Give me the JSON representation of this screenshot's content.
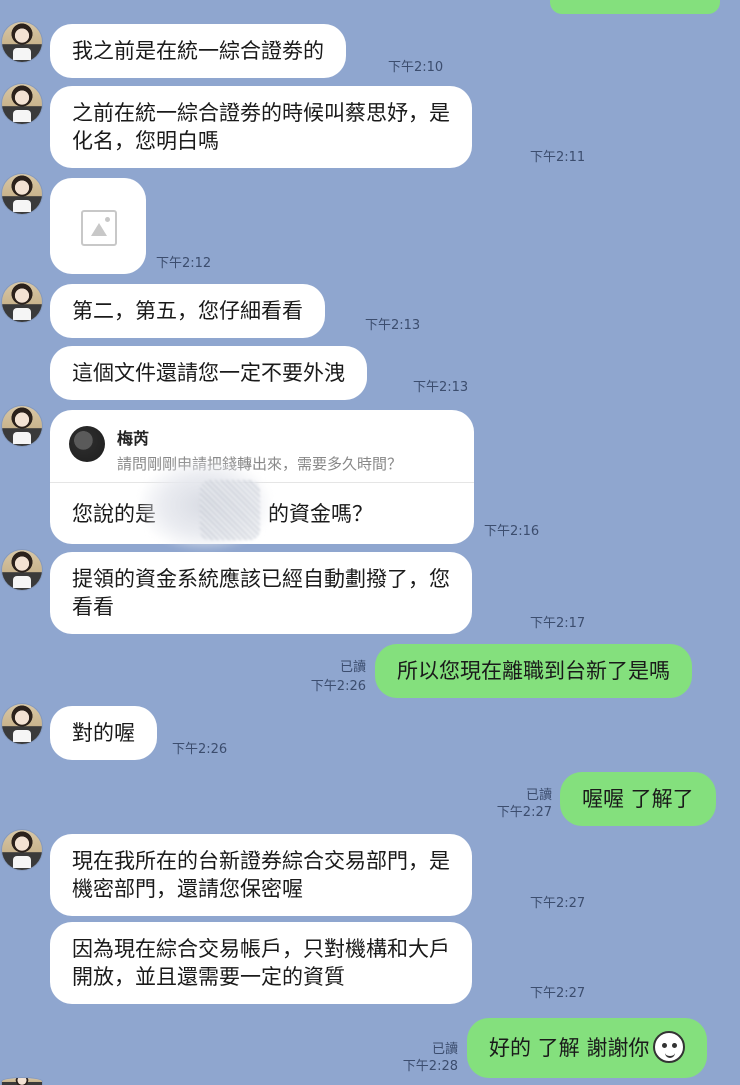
{
  "messages": [
    {
      "text": "我之前是在統一綜合證劵的",
      "time": "下午2:10"
    },
    {
      "text": "之前在統一綜合證劵的時候叫蔡思妤，是\n化名，您明白嗎",
      "time": "下午2:11"
    },
    {
      "image": "image-placeholder-icon",
      "time": "下午2:12"
    },
    {
      "text": "第二，第五，您仔細看看",
      "time": "下午2:13"
    },
    {
      "text": "這個文件還請您一定不要外洩",
      "time": "下午2:13"
    },
    {
      "reply": {
        "name": "梅芮",
        "quote": "請問剛剛申請把錢轉出來，需要多久時間？"
      },
      "text": "您說的是",
      "text_tail": "的資金嗎？",
      "time": "下午2:16"
    },
    {
      "text": "提領的資金系統應該已經自動劃撥了，您\n看看",
      "time": "下午2:17"
    },
    {
      "text": "所以您現在離職到台新了是嗎",
      "read": "已讀",
      "time": "下午2:26",
      "self": true
    },
    {
      "text": "對的喔",
      "time": "下午2:26"
    },
    {
      "text": "喔喔 了解了",
      "read": "已讀",
      "time": "下午2:27",
      "self": true
    },
    {
      "text": "現在我所在的台新證券綜合交易部門，是\n機密部門，還請您保密喔",
      "time": "下午2:27"
    },
    {
      "text": "因為現在綜合交易帳戶，只對機構和大戶\n開放，並且還需要一定的資質",
      "time": "下午2:27"
    },
    {
      "text": "好的 了解 謝謝你",
      "read": "已讀",
      "time": "下午2:28",
      "self": true,
      "emoji": "smiling-face-icon"
    }
  ],
  "colors": {
    "background": "#8fa6cf",
    "incoming": "#ffffff",
    "outgoing": "#84e07d"
  }
}
